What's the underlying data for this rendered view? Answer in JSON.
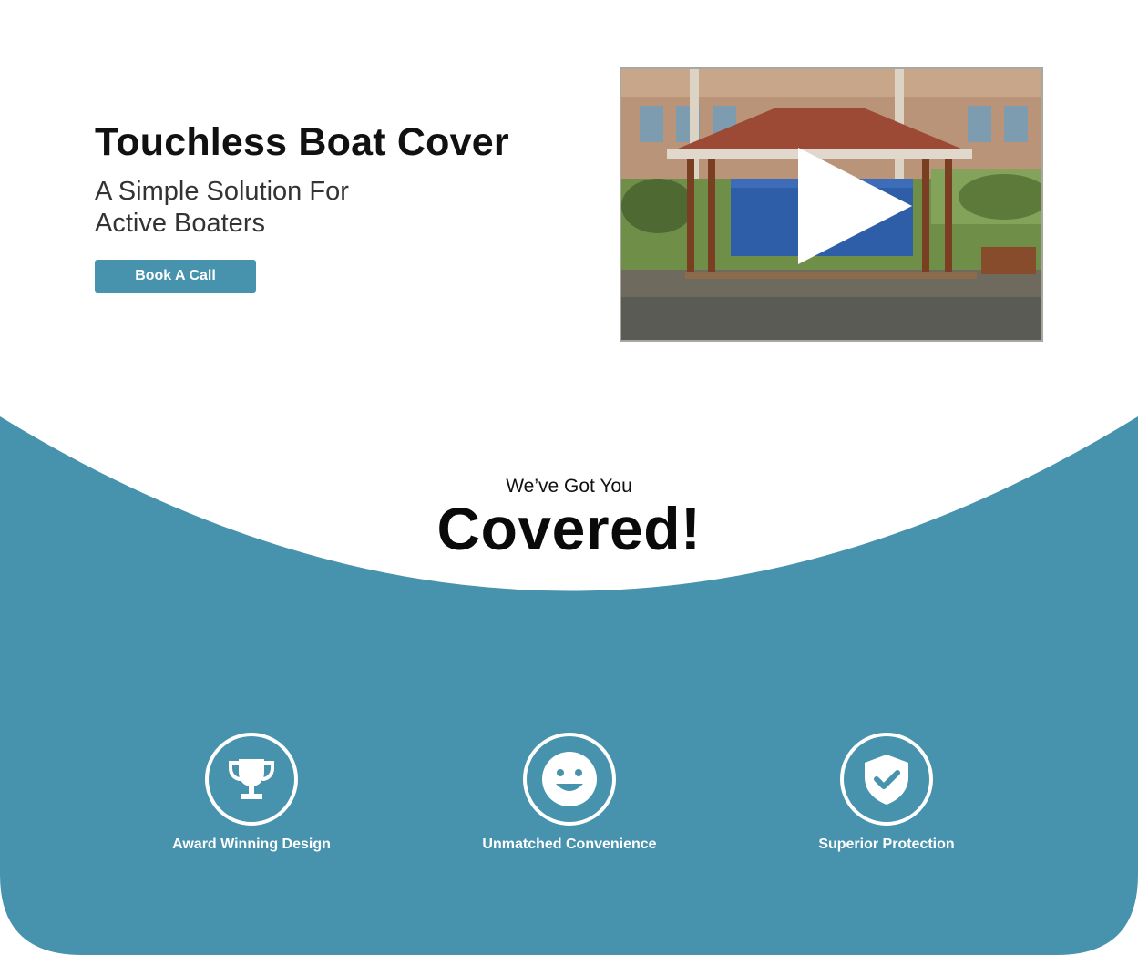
{
  "colors": {
    "accent": "#4793ae",
    "text_dark": "#111111",
    "text_light": "#ffffff",
    "background": "#ffffff"
  },
  "hero": {
    "title": "Touchless Boat Cover",
    "subtitle_line1": "A Simple Solution For",
    "subtitle_line2": "Active Boaters",
    "cta_label": "Book A Call"
  },
  "video": {
    "thumbnail_description_icon": "play-icon"
  },
  "section": {
    "tagline_small": "We’ve Got You",
    "tagline_big": "Covered!"
  },
  "features": [
    {
      "icon": "trophy-icon",
      "label": "Award Winning Design"
    },
    {
      "icon": "smiley-icon",
      "label": "Unmatched Convenience"
    },
    {
      "icon": "shield-check-icon",
      "label": "Superior Protection"
    }
  ]
}
